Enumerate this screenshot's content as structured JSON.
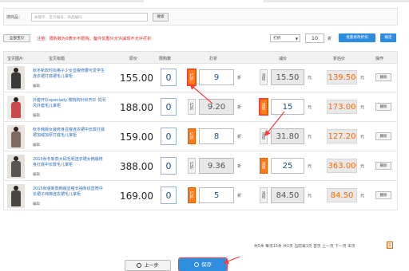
{
  "search": {
    "label": "搜商品：",
    "placeholder": "关键字、宝贝编号、商品编码",
    "button": "搜索"
  },
  "toolbar": {
    "select_all": "全部宝贝",
    "notice": "注意：限购数为0表示不限购；备件优惠只允许减现不允许打折",
    "mode": "打折",
    "discount": "10",
    "unit": "折",
    "batch_label": "批量修改折扣",
    "ok_label": "确定"
  },
  "table": {
    "headers": [
      "宝贝图片",
      "宝贝标题",
      "原价",
      "限购数",
      "打折",
      "减价",
      "折后价",
      "操作"
    ],
    "rows": [
      {
        "title": "秋冬新款时尚格子少女显瘦修腰可爱学生连衣裙打底裙毛儿掌柜",
        "edit": "编辑",
        "price": "155.00",
        "limit": "0",
        "tag_discount": "打折",
        "discount": "9",
        "discount_unit": "折",
        "tag_reduce": "减钱",
        "reduce": "15.50",
        "reduce_unit": "元",
        "final": "139.50",
        "final_unit": "元",
        "delete": "删除",
        "active": "discount"
      },
      {
        "title": "外套开衫openlady 樱桃钩针织开衫 优闲风外套毛儿掌柜",
        "edit": "编辑",
        "price": "188.00",
        "limit": "0",
        "tag_discount": "打折",
        "discount": "9.20",
        "discount_unit": "折",
        "tag_reduce": "减钱",
        "reduce": "15",
        "reduce_unit": "元",
        "final": "173.00",
        "final_unit": "元",
        "delete": "删除",
        "active": "reduce"
      },
      {
        "title": "秋冬韩版女装修身显瘦连衣裙中长款打底裙加绒加厚打底毛儿掌柜",
        "edit": "编辑",
        "price": "159.00",
        "limit": "0",
        "tag_discount": "打折",
        "discount": "8",
        "discount_unit": "折",
        "tag_reduce": "减钱",
        "reduce": "31.80",
        "reduce_unit": "元",
        "final": "127.20",
        "final_unit": "元",
        "delete": "删除",
        "active": "discount"
      },
      {
        "title": "2015秋冬新款大码毛呢连衣裙女韩版修身打底中长款毛儿掌柜",
        "edit": "编辑",
        "price": "388.00",
        "limit": "0",
        "tag_discount": "打折",
        "discount": "9.36",
        "discount_unit": "折",
        "tag_reduce": "减钱",
        "reduce": "25",
        "reduce_unit": "元",
        "final": "363.00",
        "final_unit": "元",
        "delete": "删除",
        "active": "reduce"
      },
      {
        "title": "2015秋装新款韩版显瘦长袖条纹直筒中长裙子纯棉连衣裙毛儿掌柜",
        "edit": "编辑",
        "price": "169.00",
        "limit": "0",
        "tag_discount": "打折",
        "discount": "5",
        "discount_unit": "折",
        "tag_reduce": "减钱",
        "reduce": "84.50",
        "reduce_unit": "元",
        "final": "84.50",
        "final_unit": "元",
        "delete": "删除",
        "active": "discount"
      }
    ]
  },
  "pager": {
    "text": "共5条 每页15条 共1页 当前第1页 首页 上一页 下一页 末页",
    "current": "1"
  },
  "footer": {
    "prev": "上一步",
    "save": "保存"
  },
  "colors": {
    "accent": "#2d8ce0",
    "active_tag": "#ff7a1a",
    "final_price": "#ff6a00",
    "highlight": "#ff3a3a",
    "notice": "#e02020"
  },
  "icons": {
    "prev": "circle-arrow-left-icon",
    "save": "circle-check-icon"
  }
}
